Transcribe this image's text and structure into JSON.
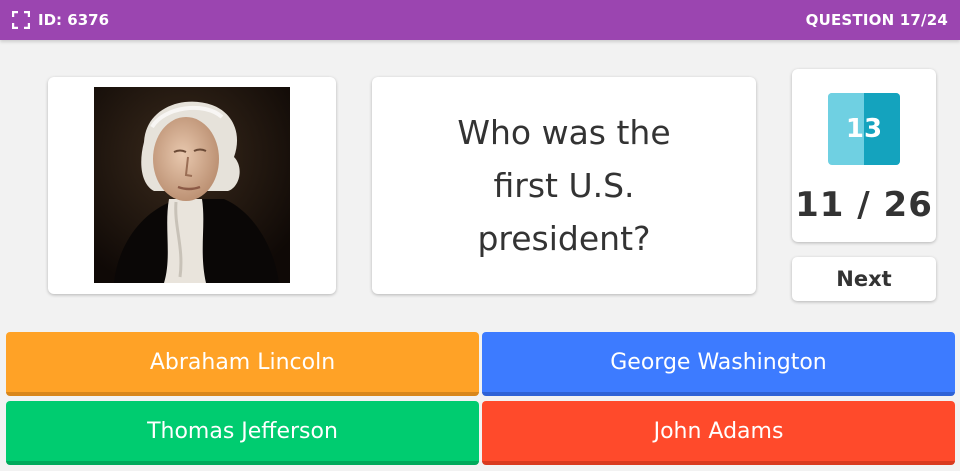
{
  "header": {
    "game_id": "ID: 6376",
    "question_counter": "QUESTION 17/24",
    "icon": "fullscreen-icon"
  },
  "question": {
    "text": "Who was the first U.S. president?",
    "image_icon": "portrait-image"
  },
  "timer": {
    "value": "13"
  },
  "score": {
    "text": "11 / 26"
  },
  "next_label": "Next",
  "answers": [
    {
      "label": "Abraham Lincoln",
      "color": "#ffa226"
    },
    {
      "label": "George Washington",
      "color": "#3d7bff"
    },
    {
      "label": "Thomas Jefferson",
      "color": "#00cc70"
    },
    {
      "label": "John Adams",
      "color": "#ff4a2b"
    }
  ],
  "colors": {
    "header_bg": "#9b45b0",
    "timer_light": "#6fd0e2",
    "timer_dark": "#14a3be"
  }
}
